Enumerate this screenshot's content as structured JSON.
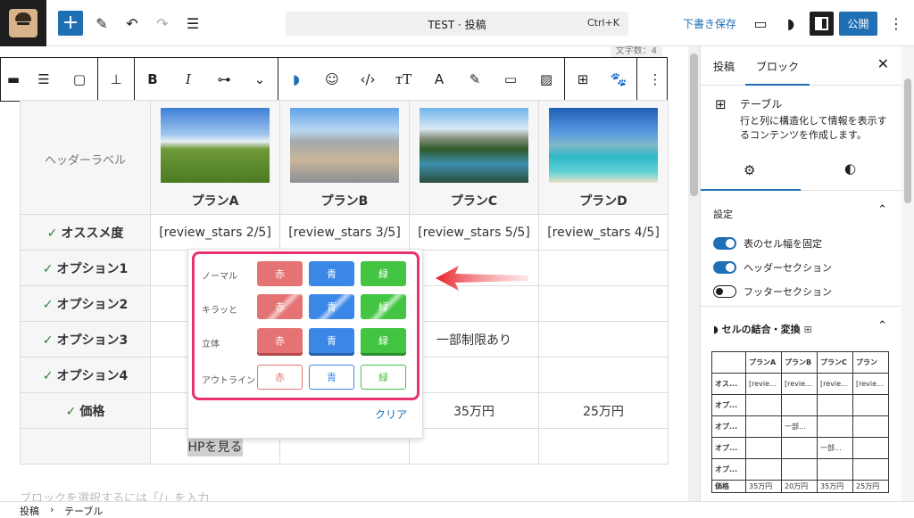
{
  "topbar": {
    "search_title": "TEST · 投稿",
    "shortcut": "Ctrl+K",
    "save_draft": "下書き保存",
    "publish": "公開"
  },
  "editor": {
    "word_count": "文字数：4",
    "hint": "ブロックを選択するには「/」を入力"
  },
  "table": {
    "header_label": "ヘッダーラベル",
    "plans": [
      "プランA",
      "プランB",
      "プランC",
      "プランD"
    ],
    "rows": [
      {
        "label": "オススメ度",
        "cells": [
          "[review_stars 2/5]",
          "[review_stars 3/5]",
          "[review_stars 5/5]",
          "[review_stars 4/5]"
        ]
      },
      {
        "label": "オプション1",
        "cells": [
          "",
          "",
          "",
          ""
        ]
      },
      {
        "label": "オプション2",
        "cells": [
          "",
          "",
          "",
          ""
        ]
      },
      {
        "label": "オプション3",
        "cells": [
          "",
          "",
          "一部制限あり",
          ""
        ]
      },
      {
        "label": "オプション4",
        "cells": [
          "",
          "",
          "",
          ""
        ]
      },
      {
        "label": "価格",
        "cells": [
          "",
          "",
          "35万円",
          "25万円"
        ]
      },
      {
        "label": "",
        "cells": [
          "HPを見る",
          "",
          "",
          ""
        ]
      }
    ]
  },
  "palette": {
    "rows": [
      {
        "label": "ノーマル",
        "buttons": [
          "赤",
          "青",
          "緑"
        ]
      },
      {
        "label": "キラッと",
        "buttons": [
          "赤",
          "青",
          "緑"
        ]
      },
      {
        "label": "立体",
        "buttons": [
          "赤",
          "青",
          "緑"
        ]
      },
      {
        "label": "アウトライン",
        "buttons": [
          "赤",
          "青",
          "緑"
        ]
      }
    ],
    "clear": "クリア",
    "colors": {
      "red": "#e57373",
      "blue": "#3b87e8",
      "green": "#43c443",
      "highlight": "#e8336d"
    }
  },
  "panel": {
    "tabs": [
      "投稿",
      "ブロック"
    ],
    "block_name": "テーブル",
    "block_desc": "行と列に構造化して情報を表示するコンテンツを作成します。",
    "settings_title": "設定",
    "toggles": [
      {
        "label": "表のセル幅を固定",
        "on": true
      },
      {
        "label": "ヘッダーセクション",
        "on": true
      },
      {
        "label": "フッターセクション",
        "on": false
      }
    ],
    "merge_title": "セルの結合・変換",
    "mini_table": [
      [
        "",
        "プランA",
        "プランB",
        "プランC",
        "プラン"
      ],
      [
        "オス...",
        "[revie...",
        "[revie...",
        "[revie...",
        "[revie..."
      ],
      [
        "オプ...",
        "",
        "",
        "",
        ""
      ],
      [
        "オプ...",
        "",
        "一部...",
        "",
        ""
      ],
      [
        "オプ...",
        "",
        "",
        "一部...",
        ""
      ],
      [
        "オプ...",
        "",
        "",
        "",
        ""
      ],
      [
        "価格",
        "35万円",
        "20万円",
        "35万円",
        "25万円"
      ]
    ]
  },
  "breadcrumb": [
    "投稿",
    "テーブル"
  ]
}
